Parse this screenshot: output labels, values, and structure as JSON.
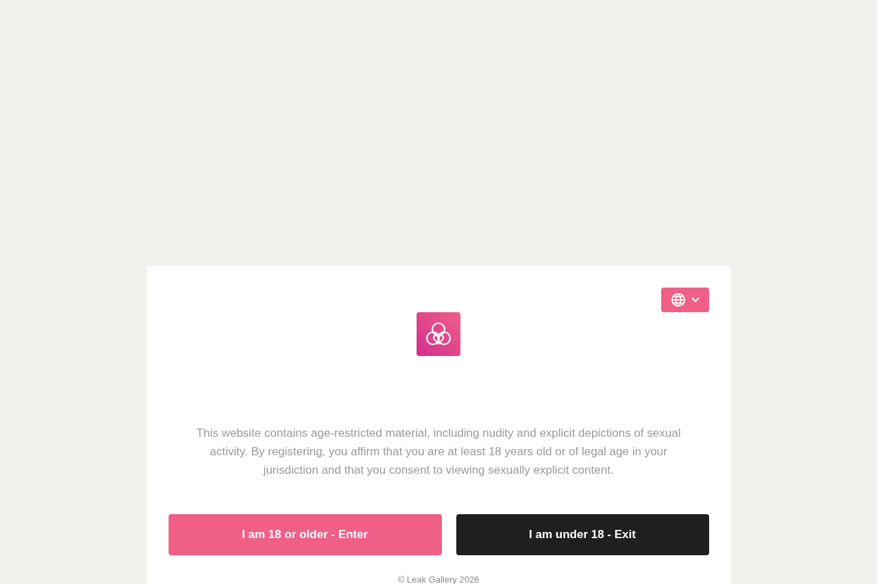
{
  "language_button": {
    "expanded": false
  },
  "notice": "This website contains age-restricted material, including nudity and explicit depictions of sexual activity. By registering, you affirm that you are at least 18 years old or of legal age in your jurisdiction and that you consent to viewing sexually explicit content.",
  "buttons": [
    {
      "label": "I am 18 or older - Enter",
      "kind": "primary"
    },
    {
      "label": "I am under 18 - Exit",
      "kind": "dark"
    }
  ],
  "footer": "© Leak Gallery 2026"
}
